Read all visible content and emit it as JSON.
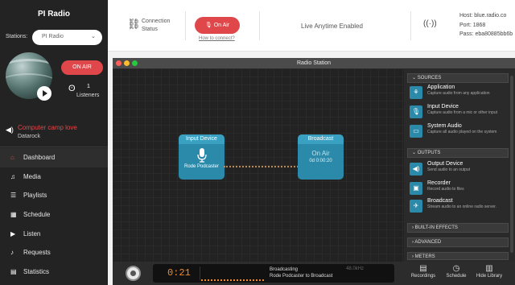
{
  "sidebar": {
    "title": "PI Radio",
    "stations_label": "Stations:",
    "station_selected": "PI Radio",
    "on_air_label": "ON AIR",
    "listeners_count": "1",
    "listeners_label": "Listeners",
    "now_playing": {
      "track": "Computer camp love",
      "artist": "Datarock"
    },
    "nav": [
      {
        "label": "Dashboard",
        "icon": "home-icon",
        "active": true
      },
      {
        "label": "Media",
        "icon": "music-note-icon"
      },
      {
        "label": "Playlists",
        "icon": "list-icon"
      },
      {
        "label": "Schedule",
        "icon": "calendar-icon"
      },
      {
        "label": "Listen",
        "icon": "play-icon"
      },
      {
        "label": "Requests",
        "icon": "music-request-icon"
      },
      {
        "label": "Statistics",
        "icon": "stats-icon"
      }
    ]
  },
  "header": {
    "connection_line1": "Connection",
    "connection_line2": "Status",
    "on_air_button": "On Air",
    "how_to_connect": "How to connect?",
    "live_status": "Live Anytime Enabled",
    "host": "Host: blue.radio.co",
    "port": "Port: 1868",
    "pass": "Pass: eba80885bb6b"
  },
  "window": {
    "title": "Radio Station",
    "input_node": {
      "title": "Input Device",
      "device": "Rode Podcaster"
    },
    "broadcast_node": {
      "title": "Broadcast",
      "status": "On Air",
      "time": "0d 0:00:20"
    },
    "sources_header": "SOURCES",
    "sources": [
      {
        "title": "Application",
        "desc": "Capture audio from any application",
        "icon": "app-icon"
      },
      {
        "title": "Input Device",
        "desc": "Capture audio from a mic or other input",
        "icon": "microphone-icon"
      },
      {
        "title": "System Audio",
        "desc": "Capture all audio played on the system",
        "icon": "monitor-icon"
      }
    ],
    "outputs_header": "OUTPUTS",
    "outputs": [
      {
        "title": "Output Device",
        "desc": "Send audio to an output",
        "icon": "speaker-icon"
      },
      {
        "title": "Recorder",
        "desc": "Record audio to files",
        "icon": "recorder-icon"
      },
      {
        "title": "Broadcast",
        "desc": "Stream audio to an online radio server.",
        "icon": "broadcast-icon"
      }
    ],
    "builtin_effects": "BUILT-IN EFFECTS",
    "advanced": "ADVANCED",
    "meters": "METERS",
    "bottom": {
      "time": "0:21",
      "status_line1": "Broadcasting",
      "status_line2": "Rode Podcaster to Broadcast",
      "kbps": "48.0kHz",
      "recordings": "Recordings",
      "schedule": "Schedule",
      "hide_library": "Hide Library"
    }
  },
  "colors": {
    "accent_red": "#e0474a",
    "node_blue": "#2b8aaa",
    "lcd_orange": "#f08a2c"
  }
}
